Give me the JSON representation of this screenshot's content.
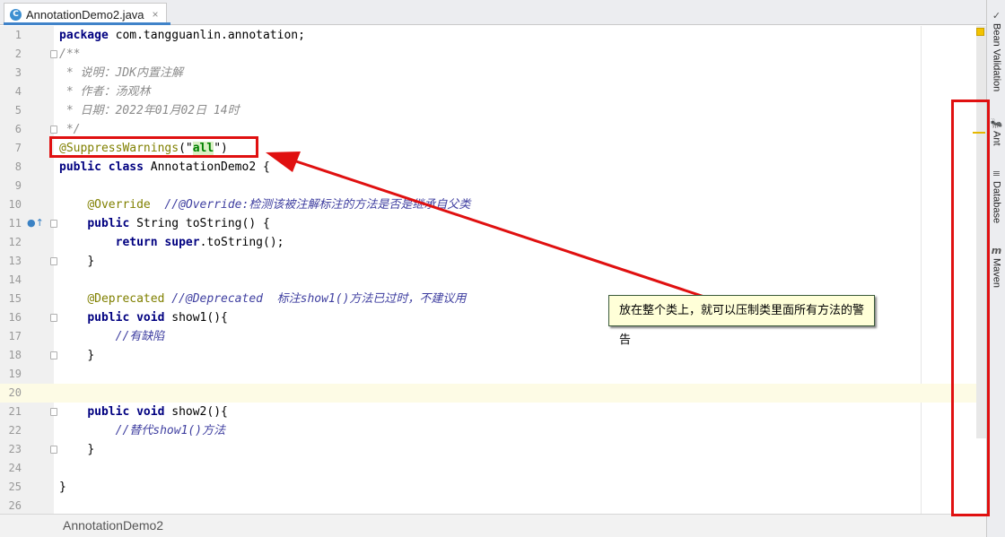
{
  "tab": {
    "icon_letter": "C",
    "title": "AnnotationDemo2.java",
    "close_glyph": "×"
  },
  "code_lines": [
    {
      "n": "1",
      "html_kind": "package",
      "text": "package com.tangguanlin.annotation;"
    },
    {
      "n": "2",
      "text": "/**"
    },
    {
      "n": "3",
      "text": " * 说明：JDK内置注解"
    },
    {
      "n": "4",
      "text": " * 作者：汤观林"
    },
    {
      "n": "5",
      "text": " * 日期：2022年01月02日 14时"
    },
    {
      "n": "6",
      "text": " */"
    },
    {
      "n": "7",
      "text": "@SuppressWarnings(\"all\")"
    },
    {
      "n": "8",
      "text": "public class AnnotationDemo2 {"
    },
    {
      "n": "9",
      "text": ""
    },
    {
      "n": "10",
      "text": "    @Override  //@Override:检测该被注解标注的方法是否是继承自父类"
    },
    {
      "n": "11",
      "text": "    public String toString() {"
    },
    {
      "n": "12",
      "text": "        return super.toString();"
    },
    {
      "n": "13",
      "text": "    }"
    },
    {
      "n": "14",
      "text": ""
    },
    {
      "n": "15",
      "text": "    @Deprecated //@Deprecated  标注show1()方法已过时，不建议用"
    },
    {
      "n": "16",
      "text": "    public void show1(){"
    },
    {
      "n": "17",
      "text": "        //有缺陷"
    },
    {
      "n": "18",
      "text": "    }"
    },
    {
      "n": "19",
      "text": ""
    },
    {
      "n": "20",
      "text": ""
    },
    {
      "n": "21",
      "text": "    public void show2(){"
    },
    {
      "n": "22",
      "text": "        //替代show1()方法"
    },
    {
      "n": "23",
      "text": "    }"
    },
    {
      "n": "24",
      "text": ""
    },
    {
      "n": "25",
      "text": "}"
    },
    {
      "n": "26",
      "text": ""
    }
  ],
  "tokens": {
    "l1_kw": "package",
    "l1_rest": " com.tangguanlin.annotation;",
    "l2": "/**",
    "l3": " * 说明：JDK内置注解",
    "l4": " * 作者：汤观林",
    "l5": " * 日期：2022年01月02日 14时",
    "l6": " */",
    "l7_ann": "@SuppressWarnings",
    "l7_open": "(\"",
    "l7_str": "all",
    "l7_close": "\")",
    "l8_kw1": "public",
    "l8_kw2": "class",
    "l8_rest": " AnnotationDemo2 {",
    "l10_ann": "@Override",
    "l10_cmt": "  //@Override:检测该被注解标注的方法是否是继承自父类",
    "l11_kw": "public",
    "l11_rest": " String toString() {",
    "l12_kw1": "return",
    "l12_kw2": "super",
    "l12_rest": ".toString();",
    "l13": "}",
    "l15_ann": "@Deprecated",
    "l15_cmt": " //@Deprecated  标注show1()方法已过时，不建议用",
    "l16_kw1": "public",
    "l16_kw2": "void",
    "l16_rest": " show1(){",
    "l17_cmt": "//有缺陷",
    "l18": "}",
    "l21_kw1": "public",
    "l21_kw2": "void",
    "l21_rest": " show2(){",
    "l22_cmt": "//替代show1()方法",
    "l23": "}",
    "l25": "}"
  },
  "gutter": {
    "override_glyph": "●↑"
  },
  "toolstrip": {
    "items": [
      {
        "icon": "✓",
        "label": "Bean Validation"
      },
      {
        "icon": "🐜",
        "label": "Ant"
      },
      {
        "icon": "≡",
        "label": "Database"
      },
      {
        "icon": "m",
        "label": "Maven"
      }
    ]
  },
  "breadcrumb": {
    "text": "AnnotationDemo2"
  },
  "callout": {
    "text": "放在整个类上，就可以压制类里面所有方法的警告"
  },
  "colors": {
    "keyword": "#000080",
    "annotation": "#808000",
    "string": "#008000",
    "comment": "#808080",
    "highlight_red": "#e01010",
    "current_line": "#fdfbe5"
  }
}
